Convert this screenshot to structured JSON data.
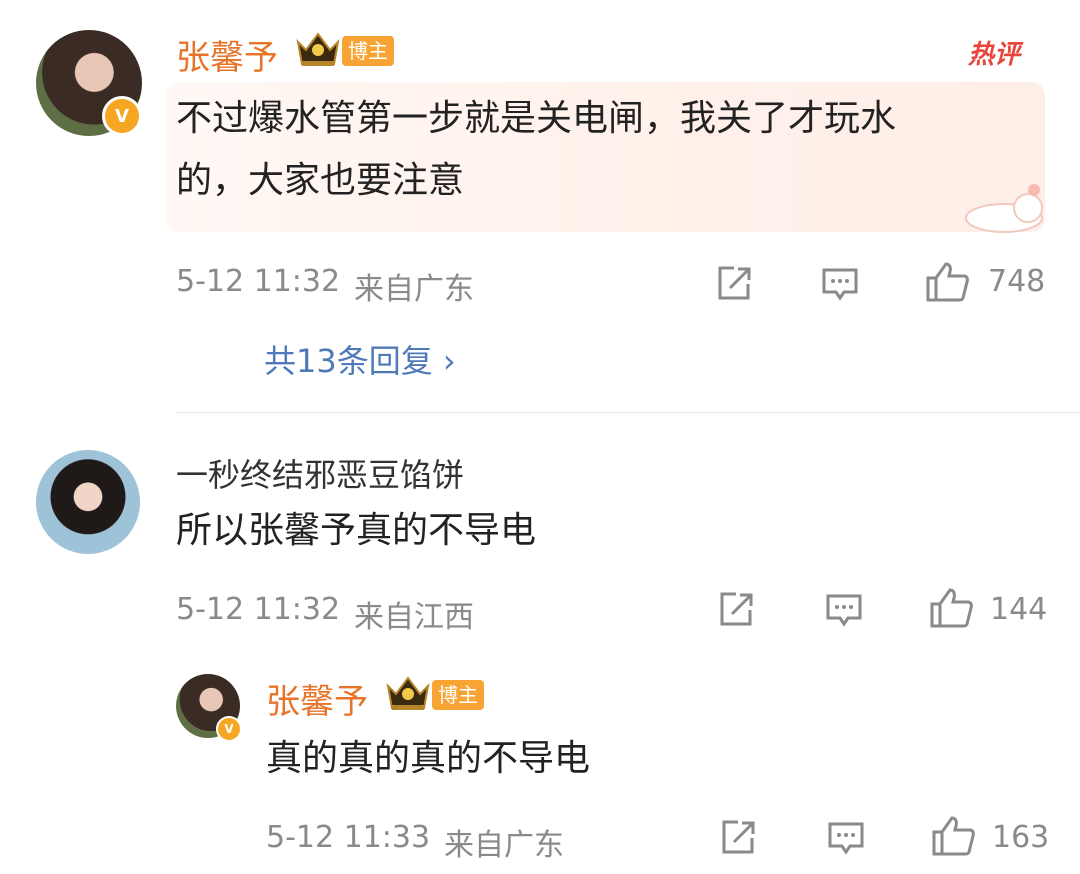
{
  "comments": [
    {
      "author": "张馨予",
      "badge": "博主",
      "hot_label": "热评",
      "text_lines": [
        "不过爆水管第一步就是关电闸，我关了才玩水",
        "的，大家也要注意"
      ],
      "time": "5-12 11:32",
      "location": "来自广东",
      "likes": "748",
      "replies_link": "共13条回复 ›",
      "verified_letter": "V"
    },
    {
      "author": "一秒终结邪恶豆馅饼",
      "text": "所以张馨予真的不导电",
      "time": "5-12 11:32",
      "location": "来自江西",
      "likes": "144"
    },
    {
      "author": "张馨予",
      "badge": "博主",
      "text": "真的真的真的不导电",
      "time": "5-12 11:33",
      "location": "来自广东",
      "likes": "163",
      "verified_letter": "V"
    }
  ],
  "icons": {
    "share": "share-icon",
    "comment": "comment-icon",
    "like": "thumbs-up-icon",
    "crown": "crown-icon"
  },
  "colors": {
    "blogger_name": "#e8742a",
    "badge_bg": "#f7a434",
    "reply_link": "#4f7ab8",
    "meta": "#8a8a8a",
    "hot_label": "#e8453c"
  }
}
